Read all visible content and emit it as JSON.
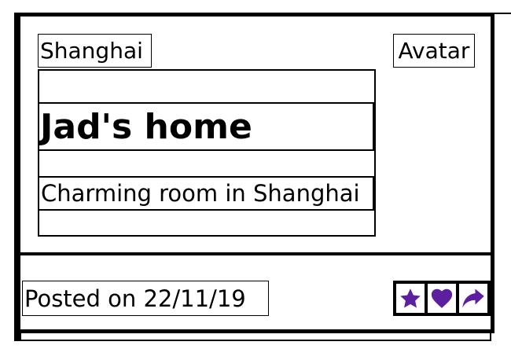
{
  "card": {
    "location": "Shanghai",
    "avatar_label": "Avatar",
    "title": "Jad's home",
    "subtitle": "Charming room in Shanghai",
    "posted": "Posted on 22/11/19"
  },
  "actions": [
    {
      "icon": "star-icon"
    },
    {
      "icon": "heart-icon"
    },
    {
      "icon": "share-icon"
    }
  ],
  "colors": {
    "icon": "#5b1fa0",
    "border": "#000000",
    "background": "#ffffff"
  }
}
